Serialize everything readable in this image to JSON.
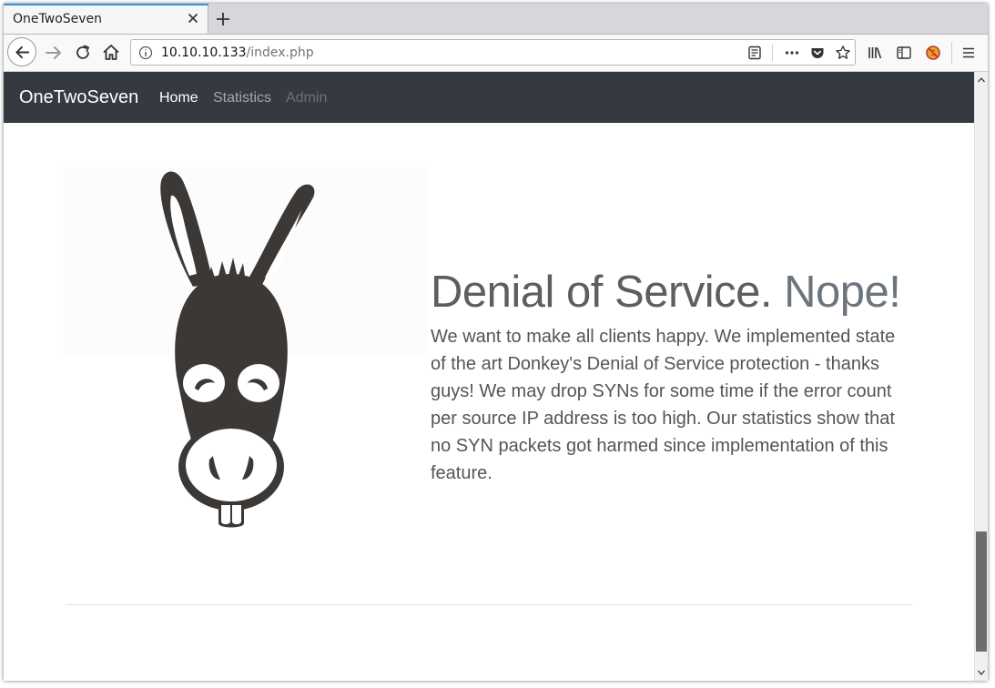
{
  "browser": {
    "tab": {
      "title": "OneTwoSeven"
    },
    "url": {
      "host": "10.10.10.133",
      "path": "/index.php"
    }
  },
  "site": {
    "brand": "OneTwoSeven",
    "nav": [
      {
        "label": "Home",
        "state": "active"
      },
      {
        "label": "Statistics",
        "state": "normal"
      },
      {
        "label": "Admin",
        "state": "disabled"
      }
    ]
  },
  "hero": {
    "title_main": "Denial of Service.",
    "title_muted": "Nope!",
    "text": "We want to make all clients happy. We implemented state of the art Donkey's Denial of Service protection - thanks guys! We may drop SYNs for some time if the error count per source IP address is too high. Our statistics show that no SYN packets got harmed since implementation of this feature."
  },
  "icons": {
    "tab_close": "close-icon",
    "new_tab": "plus-icon",
    "back": "arrow-left-icon",
    "forward": "arrow-right-icon",
    "reload": "reload-icon",
    "home": "home-icon",
    "site_info": "info-icon",
    "reader": "reader-view-icon",
    "more": "ellipsis-icon",
    "pocket": "pocket-icon",
    "bookmark": "star-icon",
    "library": "library-icon",
    "sidebar": "sidebar-icon",
    "noscript": "no-script-icon",
    "menu": "hamburger-menu-icon"
  },
  "colors": {
    "navbar_bg": "#343a40",
    "tab_accent": "#3a8fd6",
    "donkey": "#3b3836"
  },
  "scroll": {
    "position_fraction": 0.86
  }
}
